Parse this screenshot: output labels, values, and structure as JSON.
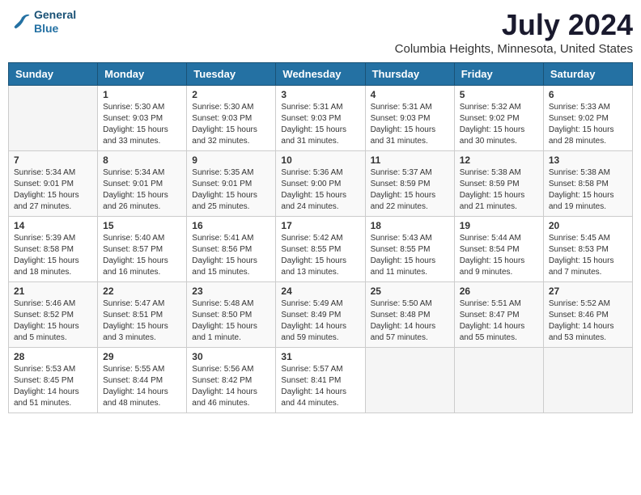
{
  "header": {
    "logo_line1": "General",
    "logo_line2": "Blue",
    "month_title": "July 2024",
    "location": "Columbia Heights, Minnesota, United States"
  },
  "days_of_week": [
    "Sunday",
    "Monday",
    "Tuesday",
    "Wednesday",
    "Thursday",
    "Friday",
    "Saturday"
  ],
  "weeks": [
    [
      {
        "day": "",
        "info": ""
      },
      {
        "day": "1",
        "info": "Sunrise: 5:30 AM\nSunset: 9:03 PM\nDaylight: 15 hours\nand 33 minutes."
      },
      {
        "day": "2",
        "info": "Sunrise: 5:30 AM\nSunset: 9:03 PM\nDaylight: 15 hours\nand 32 minutes."
      },
      {
        "day": "3",
        "info": "Sunrise: 5:31 AM\nSunset: 9:03 PM\nDaylight: 15 hours\nand 31 minutes."
      },
      {
        "day": "4",
        "info": "Sunrise: 5:31 AM\nSunset: 9:03 PM\nDaylight: 15 hours\nand 31 minutes."
      },
      {
        "day": "5",
        "info": "Sunrise: 5:32 AM\nSunset: 9:02 PM\nDaylight: 15 hours\nand 30 minutes."
      },
      {
        "day": "6",
        "info": "Sunrise: 5:33 AM\nSunset: 9:02 PM\nDaylight: 15 hours\nand 28 minutes."
      }
    ],
    [
      {
        "day": "7",
        "info": "Sunrise: 5:34 AM\nSunset: 9:01 PM\nDaylight: 15 hours\nand 27 minutes."
      },
      {
        "day": "8",
        "info": "Sunrise: 5:34 AM\nSunset: 9:01 PM\nDaylight: 15 hours\nand 26 minutes."
      },
      {
        "day": "9",
        "info": "Sunrise: 5:35 AM\nSunset: 9:01 PM\nDaylight: 15 hours\nand 25 minutes."
      },
      {
        "day": "10",
        "info": "Sunrise: 5:36 AM\nSunset: 9:00 PM\nDaylight: 15 hours\nand 24 minutes."
      },
      {
        "day": "11",
        "info": "Sunrise: 5:37 AM\nSunset: 8:59 PM\nDaylight: 15 hours\nand 22 minutes."
      },
      {
        "day": "12",
        "info": "Sunrise: 5:38 AM\nSunset: 8:59 PM\nDaylight: 15 hours\nand 21 minutes."
      },
      {
        "day": "13",
        "info": "Sunrise: 5:38 AM\nSunset: 8:58 PM\nDaylight: 15 hours\nand 19 minutes."
      }
    ],
    [
      {
        "day": "14",
        "info": "Sunrise: 5:39 AM\nSunset: 8:58 PM\nDaylight: 15 hours\nand 18 minutes."
      },
      {
        "day": "15",
        "info": "Sunrise: 5:40 AM\nSunset: 8:57 PM\nDaylight: 15 hours\nand 16 minutes."
      },
      {
        "day": "16",
        "info": "Sunrise: 5:41 AM\nSunset: 8:56 PM\nDaylight: 15 hours\nand 15 minutes."
      },
      {
        "day": "17",
        "info": "Sunrise: 5:42 AM\nSunset: 8:55 PM\nDaylight: 15 hours\nand 13 minutes."
      },
      {
        "day": "18",
        "info": "Sunrise: 5:43 AM\nSunset: 8:55 PM\nDaylight: 15 hours\nand 11 minutes."
      },
      {
        "day": "19",
        "info": "Sunrise: 5:44 AM\nSunset: 8:54 PM\nDaylight: 15 hours\nand 9 minutes."
      },
      {
        "day": "20",
        "info": "Sunrise: 5:45 AM\nSunset: 8:53 PM\nDaylight: 15 hours\nand 7 minutes."
      }
    ],
    [
      {
        "day": "21",
        "info": "Sunrise: 5:46 AM\nSunset: 8:52 PM\nDaylight: 15 hours\nand 5 minutes."
      },
      {
        "day": "22",
        "info": "Sunrise: 5:47 AM\nSunset: 8:51 PM\nDaylight: 15 hours\nand 3 minutes."
      },
      {
        "day": "23",
        "info": "Sunrise: 5:48 AM\nSunset: 8:50 PM\nDaylight: 15 hours\nand 1 minute."
      },
      {
        "day": "24",
        "info": "Sunrise: 5:49 AM\nSunset: 8:49 PM\nDaylight: 14 hours\nand 59 minutes."
      },
      {
        "day": "25",
        "info": "Sunrise: 5:50 AM\nSunset: 8:48 PM\nDaylight: 14 hours\nand 57 minutes."
      },
      {
        "day": "26",
        "info": "Sunrise: 5:51 AM\nSunset: 8:47 PM\nDaylight: 14 hours\nand 55 minutes."
      },
      {
        "day": "27",
        "info": "Sunrise: 5:52 AM\nSunset: 8:46 PM\nDaylight: 14 hours\nand 53 minutes."
      }
    ],
    [
      {
        "day": "28",
        "info": "Sunrise: 5:53 AM\nSunset: 8:45 PM\nDaylight: 14 hours\nand 51 minutes."
      },
      {
        "day": "29",
        "info": "Sunrise: 5:55 AM\nSunset: 8:44 PM\nDaylight: 14 hours\nand 48 minutes."
      },
      {
        "day": "30",
        "info": "Sunrise: 5:56 AM\nSunset: 8:42 PM\nDaylight: 14 hours\nand 46 minutes."
      },
      {
        "day": "31",
        "info": "Sunrise: 5:57 AM\nSunset: 8:41 PM\nDaylight: 14 hours\nand 44 minutes."
      },
      {
        "day": "",
        "info": ""
      },
      {
        "day": "",
        "info": ""
      },
      {
        "day": "",
        "info": ""
      }
    ]
  ]
}
